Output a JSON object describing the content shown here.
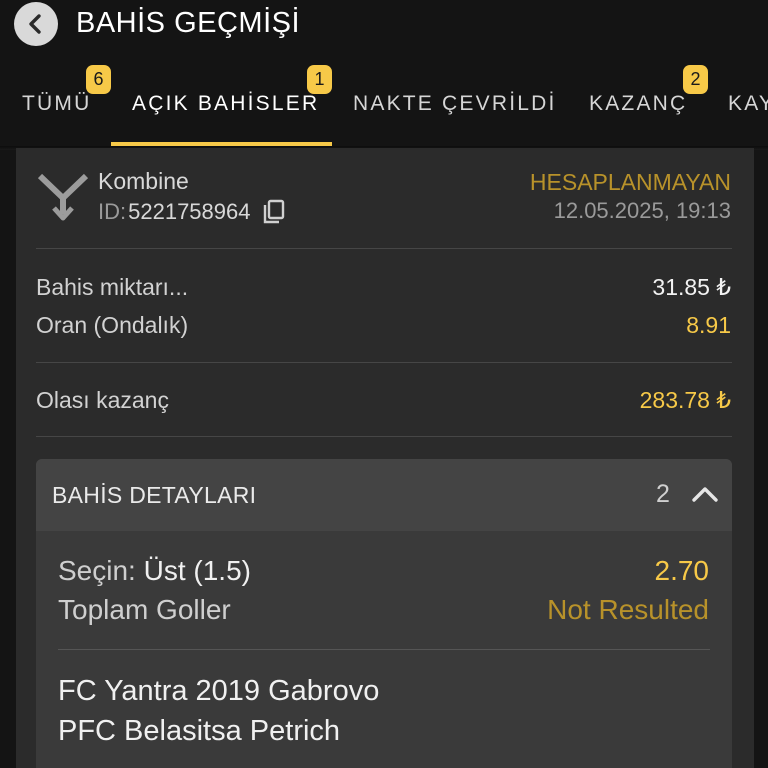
{
  "header": {
    "title": "BAHİS GEÇMİŞİ",
    "back_icon": "chevron-left-icon"
  },
  "tabs": [
    {
      "label": "TÜMÜ",
      "badge": "6",
      "active": false
    },
    {
      "label": "AÇIK BAHİSLER",
      "badge": "1",
      "active": true
    },
    {
      "label": "NAKTE ÇEVRİLDİ",
      "badge": "",
      "active": false
    },
    {
      "label": "KAZANÇ",
      "badge": "2",
      "active": false
    },
    {
      "label": "KAY",
      "badge": "",
      "active": false
    }
  ],
  "bet": {
    "type": "Kombine",
    "type_icon": "combo-bet-icon",
    "id_prefix": "ID:",
    "id": "5221758964",
    "copy_icon": "copy-icon",
    "status": "HESAPLANMAYAN",
    "date": "12.05.2025, 19:13",
    "stake_label": "Bahis miktarı...",
    "stake_value": "31.85 ₺",
    "odds_label": "Oran (Ondalık)",
    "odds_value": "8.91",
    "potential_label": "Olası kazanç",
    "potential_value": "283.78 ₺"
  },
  "details": {
    "title": "BAHİS DETAYLARI",
    "count": "2",
    "chevron_icon": "chevron-up-icon",
    "selections": [
      {
        "prefix": "Seçin:",
        "value": "Üst (1.5)",
        "odds": "2.70",
        "market": "Toplam Goller",
        "result": "Not Resulted",
        "home_team": "FC Yantra 2019 Gabrovo",
        "away_team": "PFC Belasitsa Petrich"
      }
    ]
  },
  "colors": {
    "accent": "#f7c948",
    "status": "#b8922a",
    "background": "#141414",
    "card": "#2b2b2b"
  }
}
